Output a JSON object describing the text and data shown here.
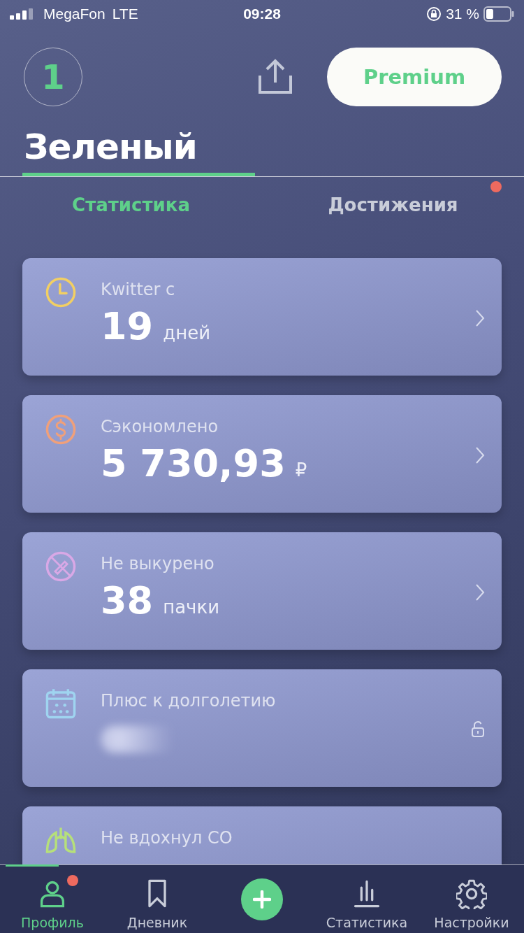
{
  "status_bar": {
    "carrier": "MegaFon",
    "network": "LTE",
    "time": "09:28",
    "battery": "31 %"
  },
  "header": {
    "level": "1",
    "premium_button": "Premium",
    "name": "Зеленый"
  },
  "tabs": [
    {
      "label": "Статистика",
      "selected": true,
      "badge": false
    },
    {
      "label": "Достижения",
      "selected": false,
      "badge": true
    }
  ],
  "cards": [
    {
      "kind": "stat",
      "color": "#f2cf63",
      "title": "Kwitter с",
      "value": "19",
      "unit": "дней"
    },
    {
      "kind": "stat",
      "color": "#f0a07a",
      "title": "Сэкономлено",
      "value": "5 730,93",
      "unit": "₽"
    },
    {
      "kind": "stat",
      "color": "#d9a8e6",
      "title": "Не выкурено",
      "value": "38",
      "unit": "пачки"
    },
    {
      "kind": "locked",
      "color": "#9fd4f0",
      "title": "Плюс к долголетию"
    },
    {
      "kind": "stat",
      "color": "#b6e07a",
      "title": "Не вдохнул CO"
    }
  ],
  "tab_bar": [
    {
      "kind": "tab",
      "label": "Профиль",
      "selected": true,
      "badge": true
    },
    {
      "kind": "tab",
      "label": "Дневник",
      "selected": false,
      "badge": false
    },
    {
      "kind": "add"
    },
    {
      "kind": "tab",
      "label": "Статистика",
      "selected": false,
      "badge": false
    },
    {
      "kind": "tab",
      "label": "Настройки",
      "selected": false,
      "badge": false
    }
  ]
}
